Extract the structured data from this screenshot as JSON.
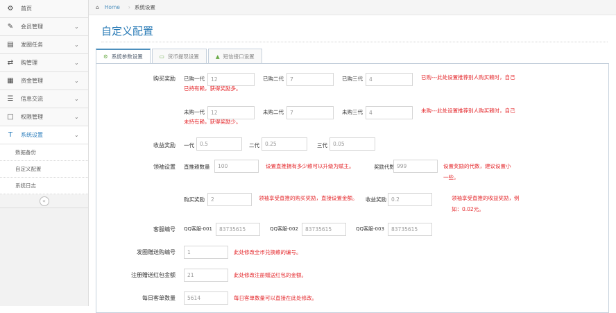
{
  "sidebar": {
    "items": [
      {
        "icon": "tachometer-icon",
        "glyph": "⚙",
        "label": "首页",
        "chev": ""
      },
      {
        "icon": "edit-icon",
        "glyph": "✎",
        "label": "会员管理",
        "chev": "⌄"
      },
      {
        "icon": "book-icon",
        "glyph": "▤",
        "label": "发圈任务",
        "chev": "⌄"
      },
      {
        "icon": "shuffle-icon",
        "glyph": "⇄",
        "label": "购管理",
        "chev": "⌄"
      },
      {
        "icon": "calendar-icon",
        "glyph": "▦",
        "label": "资金管理",
        "chev": "⌄"
      },
      {
        "icon": "list-icon",
        "glyph": "☰",
        "label": "信息交流",
        "chev": "⌄"
      },
      {
        "icon": "file-icon",
        "glyph": "□",
        "label": "权限管理",
        "chev": "⌄"
      },
      {
        "icon": "text-icon",
        "glyph": "T",
        "label": "系统设置",
        "chev": "⌄"
      }
    ],
    "subitems": [
      "数据备份",
      "自定义配置",
      "系统日志"
    ],
    "collapse_glyph": "«"
  },
  "breadcrumb": {
    "home_glyph": "⌂",
    "home": "Home",
    "sep": "›",
    "current": "系统设置"
  },
  "page_title": "自定义配置",
  "tabs": [
    {
      "glyph": "⚙",
      "label": "系统参数设置"
    },
    {
      "glyph": "▭",
      "label": "货币提现设置"
    },
    {
      "glyph": "▲",
      "label": "短信接口设置"
    }
  ],
  "form": {
    "purchase_reward": {
      "label": "购买奖励",
      "row1": {
        "l1": "已购一代",
        "v1": "12",
        "l2": "已购二代",
        "v2": "7",
        "l3": "已购三代",
        "v3": "4",
        "hint": "已购---此处设置推荐别人购买赖时，自己已持有赖，获得奖励多。"
      },
      "row2": {
        "l1": "未购一代",
        "v1": "12",
        "l2": "未购二代",
        "v2": "7",
        "l3": "未购三代",
        "v3": "4",
        "hint": "未购---此处设置推荐别人购买赖时，自己未持有赖，获得奖励少。"
      }
    },
    "income_reward": {
      "label": "收益奖励",
      "l1": "一代",
      "v1": "0.5",
      "l2": "二代",
      "v2": "0.25",
      "l3": "三代",
      "v3": "0.05"
    },
    "leader": {
      "label": "领袖设置",
      "l1": "直推赖数量",
      "v1": "100",
      "hint1": "设置直推拥有多少赖可以升级为赋主。",
      "l2": "奖励代数",
      "v2": "999",
      "hint2": "设置奖励的代数，建议设置小一些。",
      "l3": "购买奖励",
      "v3": "2",
      "hint3": "领袖享受直推的购买奖励，直接设置金额。",
      "l4": "收益奖励",
      "v4": "0.2",
      "hint4": "领袖享受直推的收益奖励，例如：0.02元。"
    },
    "service": {
      "label": "客服编号",
      "l1": "QQ客服-001",
      "v1": "83735615",
      "l2": "QQ客服-002",
      "v2": "83735615",
      "l3": "QQ客服-003",
      "v3": "83735615"
    },
    "gift_id": {
      "label": "发圈赠送购编号",
      "value": "1",
      "hint": "此处修改全币兑换赖的编号。"
    },
    "register_gift": {
      "label": "注册赠送红包金额",
      "value": "21",
      "hint": "此处修改注册赠送红包的金额。"
    },
    "daily_orders": {
      "label": "每日客单数量",
      "value": "5614",
      "hint": "每日客单数量可以直接在此处修改。"
    }
  }
}
